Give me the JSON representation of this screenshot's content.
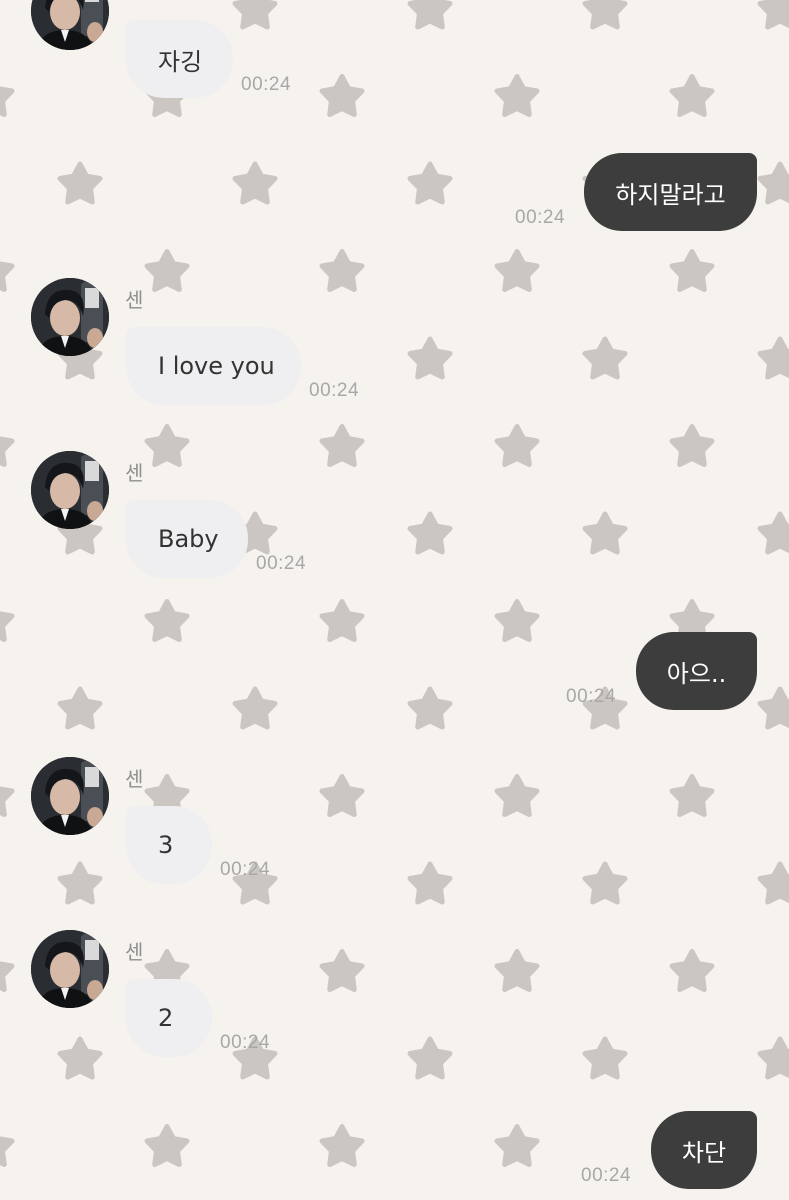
{
  "chat": {
    "theme": {
      "background": "#f6f3ef",
      "star_color": "#cbc6c1",
      "incoming_bubble": "#efeff1",
      "outgoing_bubble": "#3d3d3d"
    },
    "messages": [
      {
        "id": "m1",
        "side": "in",
        "sender": "",
        "text": "자깅",
        "time": "00:24"
      },
      {
        "id": "m2",
        "side": "out",
        "sender": "",
        "text": "하지말라고",
        "time": "00:24"
      },
      {
        "id": "m3",
        "side": "in",
        "sender": "센",
        "text": "I love you",
        "time": "00:24"
      },
      {
        "id": "m4",
        "side": "in",
        "sender": "센",
        "text": "Baby",
        "time": "00:24"
      },
      {
        "id": "m5",
        "side": "out",
        "sender": "",
        "text": "아으..",
        "time": "00:24"
      },
      {
        "id": "m6",
        "side": "in",
        "sender": "센",
        "text": "3",
        "time": "00:24"
      },
      {
        "id": "m7",
        "side": "in",
        "sender": "센",
        "text": "2",
        "time": "00:24"
      },
      {
        "id": "m8",
        "side": "out",
        "sender": "",
        "text": "차단",
        "time": "00:24"
      }
    ]
  }
}
